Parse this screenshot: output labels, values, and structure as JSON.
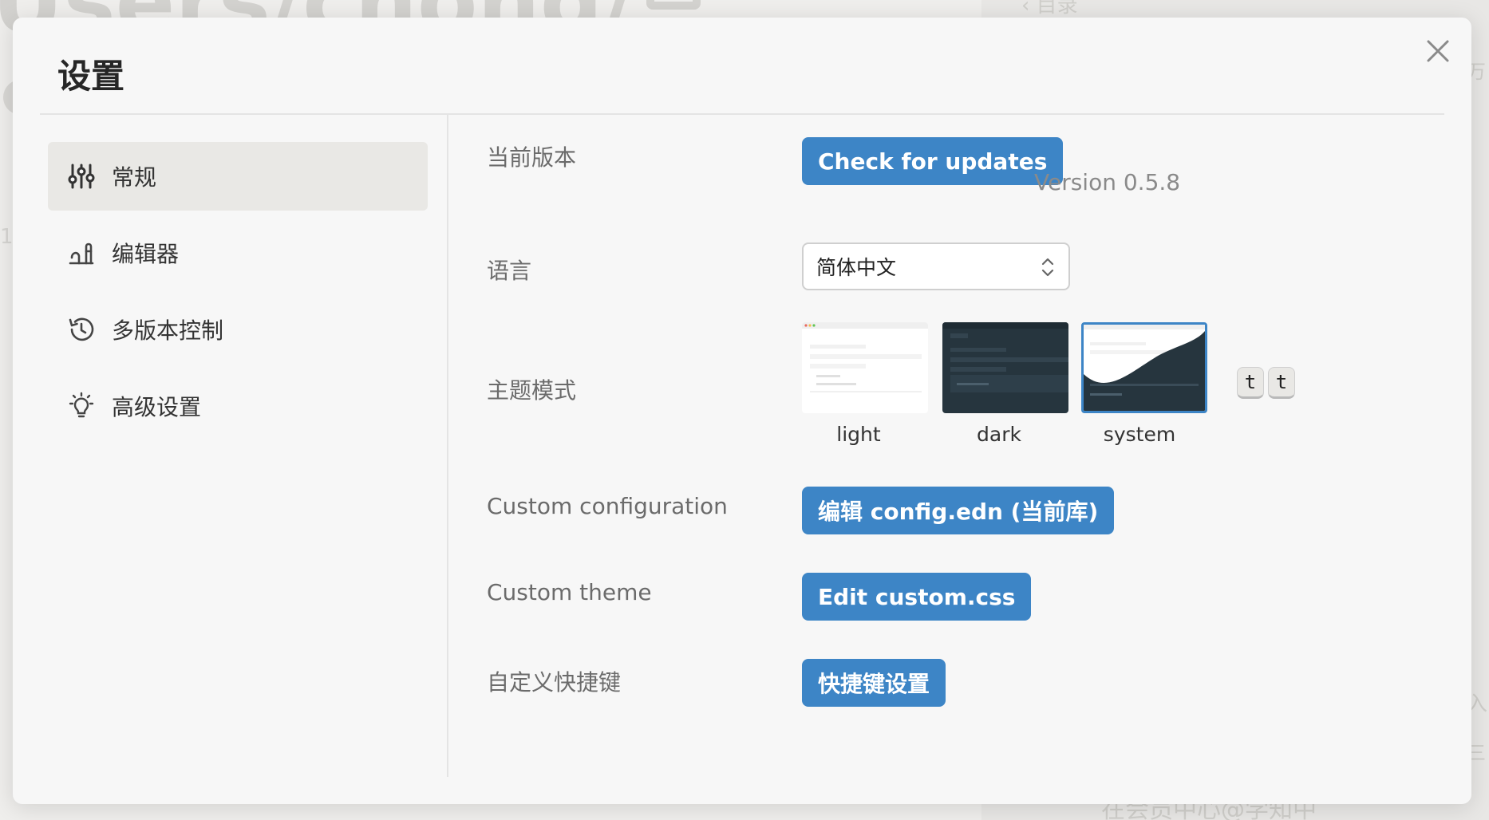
{
  "background": {
    "title": "Users/chong/",
    "right_header": "目录",
    "right_fragment_1": "万",
    "right_fragment_2": "入",
    "right_fragment_3": "三",
    "bottom_text": "在会员中心@学知中"
  },
  "modal": {
    "title": "设置"
  },
  "sidebar": {
    "items": [
      {
        "label": "常规",
        "icon": "sliders-icon",
        "active": true
      },
      {
        "label": "编辑器",
        "icon": "editor-icon",
        "active": false
      },
      {
        "label": "多版本控制",
        "icon": "history-icon",
        "active": false
      },
      {
        "label": "高级设置",
        "icon": "lightbulb-icon",
        "active": false
      }
    ]
  },
  "settings": {
    "version": {
      "label": "当前版本",
      "button": "Check for updates",
      "text": "Version 0.5.8"
    },
    "language": {
      "label": "语言",
      "selected": "简体中文"
    },
    "theme": {
      "label": "主题模式",
      "options": [
        "light",
        "dark",
        "system"
      ],
      "selected": "system",
      "shortcut_keys": [
        "t",
        "t"
      ]
    },
    "custom_config": {
      "label": "Custom configuration",
      "button": "编辑 config.edn (当前库)"
    },
    "custom_theme": {
      "label": "Custom theme",
      "button": "Edit custom.css"
    },
    "shortcuts": {
      "label": "自定义快捷键",
      "button": "快捷键设置"
    }
  },
  "colors": {
    "accent": "#3d85c6",
    "dark_theme": "#26353e",
    "active_item": "#e9e8e5"
  }
}
